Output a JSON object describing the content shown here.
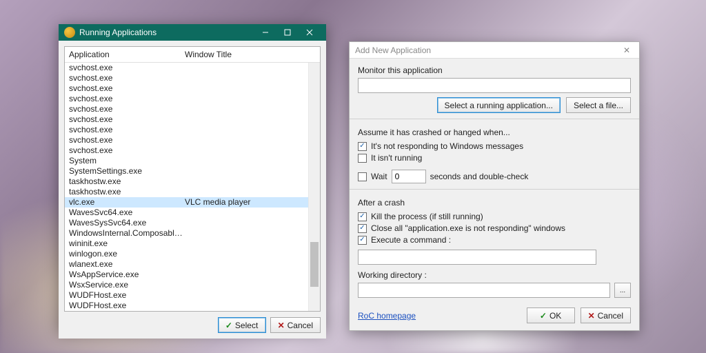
{
  "colors": {
    "titlebar": "#0d6b5f",
    "selection": "#cde8ff"
  },
  "left": {
    "title": "Running Applications",
    "columns": {
      "app": "Application",
      "win": "Window Title"
    },
    "selected_index": 13,
    "rows": [
      {
        "app": "svchost.exe",
        "win": ""
      },
      {
        "app": "svchost.exe",
        "win": ""
      },
      {
        "app": "svchost.exe",
        "win": ""
      },
      {
        "app": "svchost.exe",
        "win": ""
      },
      {
        "app": "svchost.exe",
        "win": ""
      },
      {
        "app": "svchost.exe",
        "win": ""
      },
      {
        "app": "svchost.exe",
        "win": ""
      },
      {
        "app": "svchost.exe",
        "win": ""
      },
      {
        "app": "svchost.exe",
        "win": ""
      },
      {
        "app": "System",
        "win": ""
      },
      {
        "app": "SystemSettings.exe",
        "win": ""
      },
      {
        "app": "taskhostw.exe",
        "win": ""
      },
      {
        "app": "taskhostw.exe",
        "win": ""
      },
      {
        "app": "vlc.exe",
        "win": "VLC media player"
      },
      {
        "app": "WavesSvc64.exe",
        "win": ""
      },
      {
        "app": "WavesSysSvc64.exe",
        "win": ""
      },
      {
        "app": "WindowsInternal.ComposableShell.E...",
        "win": ""
      },
      {
        "app": "wininit.exe",
        "win": ""
      },
      {
        "app": "winlogon.exe",
        "win": ""
      },
      {
        "app": "wlanext.exe",
        "win": ""
      },
      {
        "app": "WsAppService.exe",
        "win": ""
      },
      {
        "app": "WsxService.exe",
        "win": ""
      },
      {
        "app": "WUDFHost.exe",
        "win": ""
      },
      {
        "app": "WUDFHost.exe",
        "win": ""
      }
    ],
    "buttons": {
      "select": "Select",
      "cancel": "Cancel"
    }
  },
  "right": {
    "title": "Add New Application",
    "monitor_label": "Monitor this application",
    "monitor_value": "",
    "btn_select_running": "Select a running application...",
    "btn_select_file": "Select a file...",
    "assume_heading": "Assume it has crashed or hanged when...",
    "chk_not_responding": {
      "checked": true,
      "label": "It's not responding to Windows messages"
    },
    "chk_not_running": {
      "checked": false,
      "label": "It isn't running"
    },
    "chk_wait": {
      "checked": false,
      "label": "Wait",
      "value": "0",
      "suffix": "seconds and double-check"
    },
    "after_heading": "After a crash",
    "chk_kill": {
      "checked": true,
      "label": "Kill the process (if still running)"
    },
    "chk_close_nr": {
      "checked": true,
      "label": "Close all \"application.exe is not responding\" windows"
    },
    "chk_exec": {
      "checked": true,
      "label": "Execute a command :"
    },
    "exec_value": "",
    "workdir_label": "Working directory :",
    "workdir_value": "",
    "browse": "...",
    "link": "RoC homepage",
    "ok": "OK",
    "cancel": "Cancel"
  }
}
